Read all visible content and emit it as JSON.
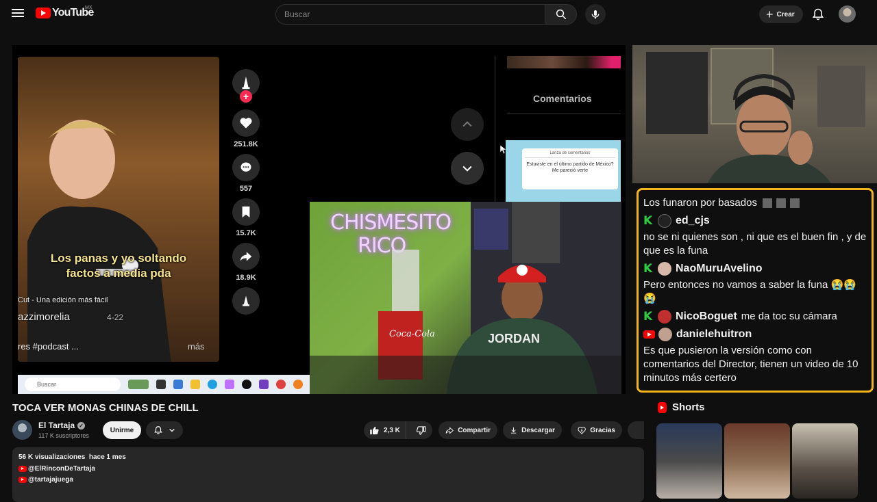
{
  "header": {
    "logo_text": "YouTube",
    "region": "MX",
    "search_placeholder": "Buscar",
    "create_label": "Crear"
  },
  "player": {
    "tiktok": {
      "caption_line1": "Los panas y yo soltando",
      "caption_line2": "factos a media pda",
      "cut_text": "Cut - Una edición más fácil",
      "username": "azzimorelia",
      "username_suffix": "4-22",
      "tags": "res #podcast ...",
      "more": "más",
      "counts": {
        "likes": "251.8K",
        "comments": "557",
        "saves": "15.7K",
        "shares": "18.9K"
      }
    },
    "comments_title": "Comentarios",
    "popup_title": "Lanza de comentarios",
    "popup_message": "Estuviste en el último partido de México? Me pareció verte",
    "neon_line1": "CHISMESITO",
    "neon_line2": "RICO",
    "taskbar_search": "Buscar",
    "jersey": "JORDAN",
    "cooler": "Coca-Cola"
  },
  "chat": {
    "top_message": "Los funaron por basados",
    "messages": [
      {
        "platform": "kick",
        "user": "ed_cjs",
        "text": "no se ni quienes son , ni que es el buen fin , y de que es la funa",
        "inline": false
      },
      {
        "platform": "kick",
        "user": "NaoMuruAvelino",
        "text": "Pero entonces no vamos a saber la funa 😭😭😭",
        "inline": false
      },
      {
        "platform": "kick",
        "user": "NicoBoguet",
        "text": "me da toc su cámara",
        "inline": true
      },
      {
        "platform": "youtube",
        "user": "danielehuitron",
        "text": "Es que pusieron la versión como con comentarios del Director, tienen un video de 10 minutos más certero",
        "inline": false
      }
    ]
  },
  "video": {
    "title": "TOCA VER MONAS CHINAS DE CHILL",
    "channel_name": "El Tartaja",
    "subscribers": "117 K suscriptores",
    "join_label": "Unirme",
    "likes": "2,3 K",
    "share_label": "Compartir",
    "download_label": "Descargar",
    "thanks_label": "Gracias"
  },
  "description": {
    "views": "56 K visualizaciones",
    "date": "hace 1 mes",
    "links": [
      "@ElRinconDeTartaja",
      "@tartajajuega"
    ]
  },
  "shorts": {
    "title": "Shorts"
  },
  "colors": {
    "chat_border": "#f4b51c",
    "kick_green": "#2ecc40",
    "youtube_red": "#ff0000",
    "tiktok_pink": "#fe2c55"
  }
}
